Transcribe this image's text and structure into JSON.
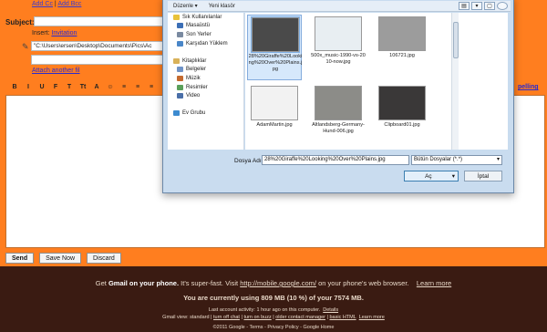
{
  "compose": {
    "add_cc": "Add Cc",
    "separator": "|",
    "add_bcc": "Add Bcc",
    "subject_label": "Subject:",
    "insert_label": "Insert:",
    "invitation_link": "Invitation",
    "attachment_path": "\"C:\\Users\\ersen\\Desktop\\Documents\\Pics\\Ac",
    "attach_another": "Attach another fil",
    "spelling": "pelling",
    "toolbar_icons": [
      "B",
      "I",
      "U",
      "F",
      "T",
      "Tt",
      "A",
      "☺",
      "≡",
      "≡",
      "≡",
      "≡",
      "≡"
    ]
  },
  "buttons": {
    "send": "Send",
    "save_now": "Save Now",
    "discard": "Discard"
  },
  "footer": {
    "line1_pre": "Get ",
    "line1_bold": "Gmail on your phone.",
    "line1_mid": " It's super-fast. Visit ",
    "line1_link": "http://mobile.google.com/",
    "line1_post": " on your phone's web browser.",
    "line1_learn": "Learn more",
    "storage": "You are currently using 809 MB (10 %) of your 7574 MB.",
    "activity": "Last account activity: 1 hour ago on this computer.",
    "details": "Details",
    "view_label": "Gmail view: standard |",
    "turn_off_chat": "turn off chat",
    "turn_on_buzz": "turn on buzz",
    "older_contact": "older contact manager",
    "basic_html": "basic HTML",
    "learn_more2": "Learn more",
    "copyright": "©2011 Google - Terms - Privacy Policy - Google Home"
  },
  "dialog": {
    "menu_organize": "Düzenle ▾",
    "menu_new_folder": "Yeni klasör",
    "view_icons": [
      "▤",
      "▾",
      "▢"
    ],
    "help": "?",
    "nav": [
      {
        "label": "Sık Kullanılanlar",
        "header": true,
        "color": "#e8c23a"
      },
      {
        "label": "Masaüstü",
        "header": false,
        "color": "#3c6fb6"
      },
      {
        "label": "Son Yerler",
        "header": false,
        "color": "#7a8aa0"
      },
      {
        "label": "Karşıdan Yüklem",
        "header": false,
        "color": "#4a86c8"
      },
      {
        "label": "",
        "header": false,
        "color": ""
      },
      {
        "label": "Kitaplıklar",
        "header": true,
        "color": "#d9b25a"
      },
      {
        "label": "Belgeler",
        "header": false,
        "color": "#6f93c8"
      },
      {
        "label": "Müzik",
        "header": false,
        "color": "#c46a2f"
      },
      {
        "label": "Resimler",
        "header": false,
        "color": "#5aa05a"
      },
      {
        "label": "Video",
        "header": false,
        "color": "#4a6fa8"
      },
      {
        "label": "",
        "header": false,
        "color": ""
      },
      {
        "label": "Ev Grubu",
        "header": true,
        "color": "#3d8bd0"
      }
    ],
    "files": [
      {
        "name": "28%20Giraffe%20Looking%20Over%20Plains.jpg",
        "selected": true,
        "color": "#4a4a4a"
      },
      {
        "name": "500x_music-1990-vs-2010-now.jpg",
        "selected": false,
        "color": "#e8eef2"
      },
      {
        "name": "106721.jpg",
        "selected": false,
        "color": "#9c9c9c"
      },
      {
        "name": "AdamMartin.jpg",
        "selected": false,
        "color": "#f2f2f2"
      },
      {
        "name": "Altlandsberg-Germany-Hund-006.jpg",
        "selected": false,
        "color": "#8c8c88"
      },
      {
        "name": "Clipboard01.jpg",
        "selected": false,
        "color": "#3a3838"
      }
    ],
    "filename_label": "Dosya Adı:",
    "filename_value": "28%20Giraffe%20Looking%20Over%20Plains.jpg",
    "filetype_value": "Bütün Dosyalar (*.*)",
    "open_button": "Aç",
    "cancel_button": "İptal"
  }
}
